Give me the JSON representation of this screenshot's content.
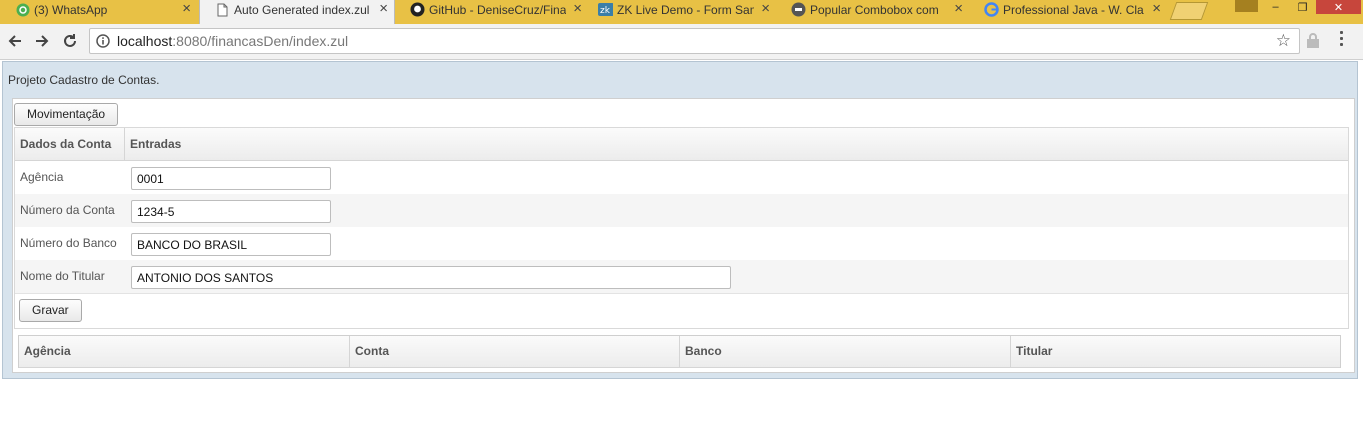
{
  "browser": {
    "tabs": [
      {
        "label": "(3) WhatsApp",
        "icon": "whatsapp-icon",
        "active": false
      },
      {
        "label": "Auto Generated index.zul",
        "icon": "page-icon",
        "active": true
      },
      {
        "label": "GitHub - DeniseCruz/Fina",
        "icon": "github-icon",
        "active": false
      },
      {
        "label": "ZK Live Demo - Form Sam",
        "icon": "zk-icon",
        "active": false
      },
      {
        "label": "Popular Combobox com",
        "icon": "popular-icon",
        "active": false
      },
      {
        "label": "Professional Java - W. Cla",
        "icon": "google-icon",
        "active": false
      }
    ],
    "url_host": "localhost",
    "url_rest": ":8080/financasDen/index.zul",
    "accent": "#e8c145"
  },
  "page": {
    "title": "Projeto Cadastro de Contas.",
    "tab_button": "Movimentação",
    "grid": {
      "headers": [
        "Dados da Conta",
        "Entradas"
      ],
      "rows": [
        {
          "label": "Agência",
          "value": "0001"
        },
        {
          "label": "Número da Conta",
          "value": "1234-5"
        },
        {
          "label": "Número do Banco",
          "value": "BANCO DO BRASIL"
        },
        {
          "label": "Nome do Titular",
          "value": "ANTONIO DOS SANTOS"
        }
      ],
      "save_button": "Gravar"
    },
    "list": {
      "columns": [
        "Agência",
        "Conta",
        "Banco",
        "Titular"
      ]
    }
  }
}
